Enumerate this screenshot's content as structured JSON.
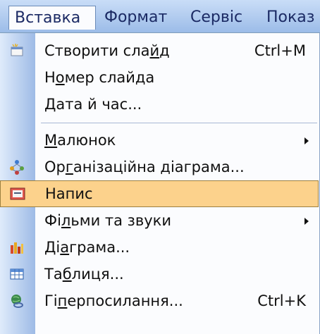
{
  "menubar": {
    "items": [
      {
        "label": "Вставка",
        "active": true
      },
      {
        "label": "Формат"
      },
      {
        "label": "Сервіс"
      },
      {
        "label": "Показ"
      }
    ]
  },
  "dropdown": {
    "items": [
      {
        "pre": "Створити сла",
        "u": "й",
        "post": "д",
        "shortcut": "Ctrl+M",
        "icon": "new-slide-icon"
      },
      {
        "pre": "Н",
        "u": "о",
        "post": "мер слайда"
      },
      {
        "pre": "",
        "u": "Д",
        "post": "ата й час..."
      },
      {
        "pre": "",
        "u": "М",
        "post": "алюнок",
        "submenu": true
      },
      {
        "pre": "Ор",
        "u": "г",
        "post": "анізаційна діаграма...",
        "icon": "org-chart-icon"
      },
      {
        "pre": "Напис",
        "u": "",
        "post": "",
        "icon": "text-box-icon",
        "highlighted": true
      },
      {
        "pre": "Фі",
        "u": "л",
        "post": "ьми та звуки",
        "submenu": true
      },
      {
        "pre": "Ді",
        "u": "а",
        "post": "грама...",
        "icon": "chart-icon"
      },
      {
        "pre": "Та",
        "u": "б",
        "post": "лиця...",
        "icon": "table-icon"
      },
      {
        "pre": "Гі",
        "u": "п",
        "post": "ерпосилання...",
        "shortcut": "Ctrl+K",
        "icon": "hyperlink-icon"
      }
    ]
  },
  "colors": {
    "highlight": "#fcd28c",
    "menubar": "#b3cdf0",
    "gutter": "#9ebbe6"
  }
}
